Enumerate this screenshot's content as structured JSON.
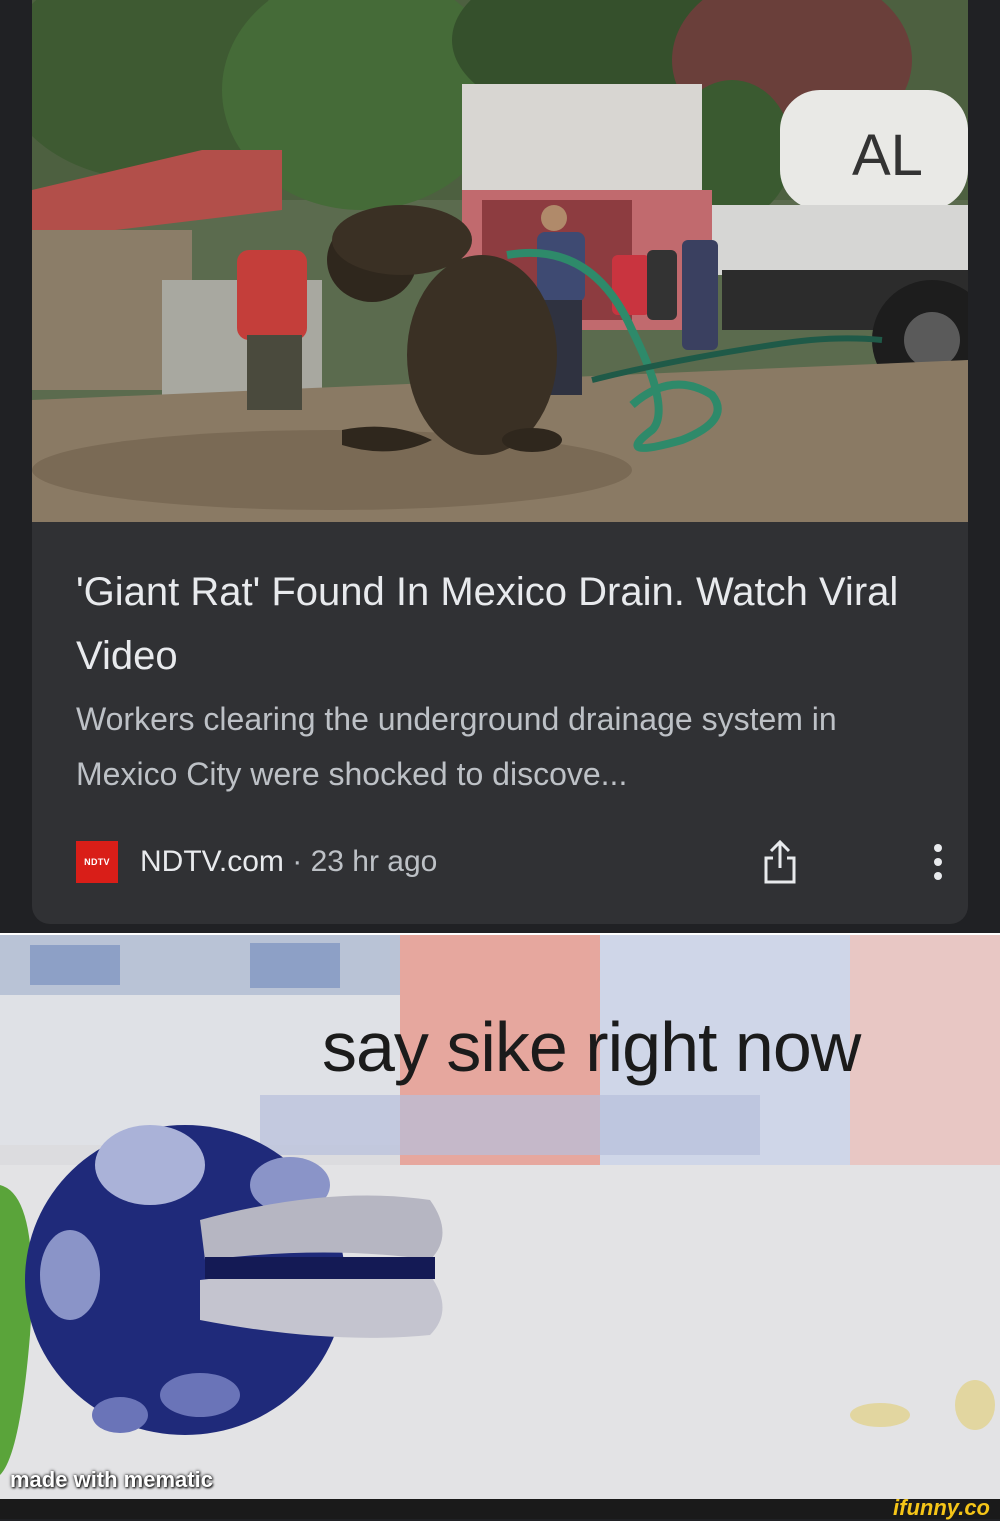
{
  "article": {
    "headline": "'Giant Rat' Found In Mexico Drain. Watch Viral Video",
    "snippet": "Workers clearing the underground drainage system in Mexico City were shocked to discove...",
    "source_logo_text": "NDTV",
    "source_name": "NDTV.com",
    "separator": " · ",
    "time_ago": "23 hr ago",
    "photo_truck_lettering": "AL",
    "share_icon": "share-icon",
    "more_icon": "more-vertical-icon"
  },
  "meme": {
    "caption": "say sike right now",
    "watermark": "made with mematic"
  },
  "footer": {
    "watermark": "ifunny.co"
  },
  "colors": {
    "card_bg": "#303134",
    "page_bg": "#202124",
    "headline": "#e8eaed",
    "snippet": "#bdc1c6",
    "ndtv_red": "#d91e18",
    "ifunny_yellow": "#f5c518"
  }
}
